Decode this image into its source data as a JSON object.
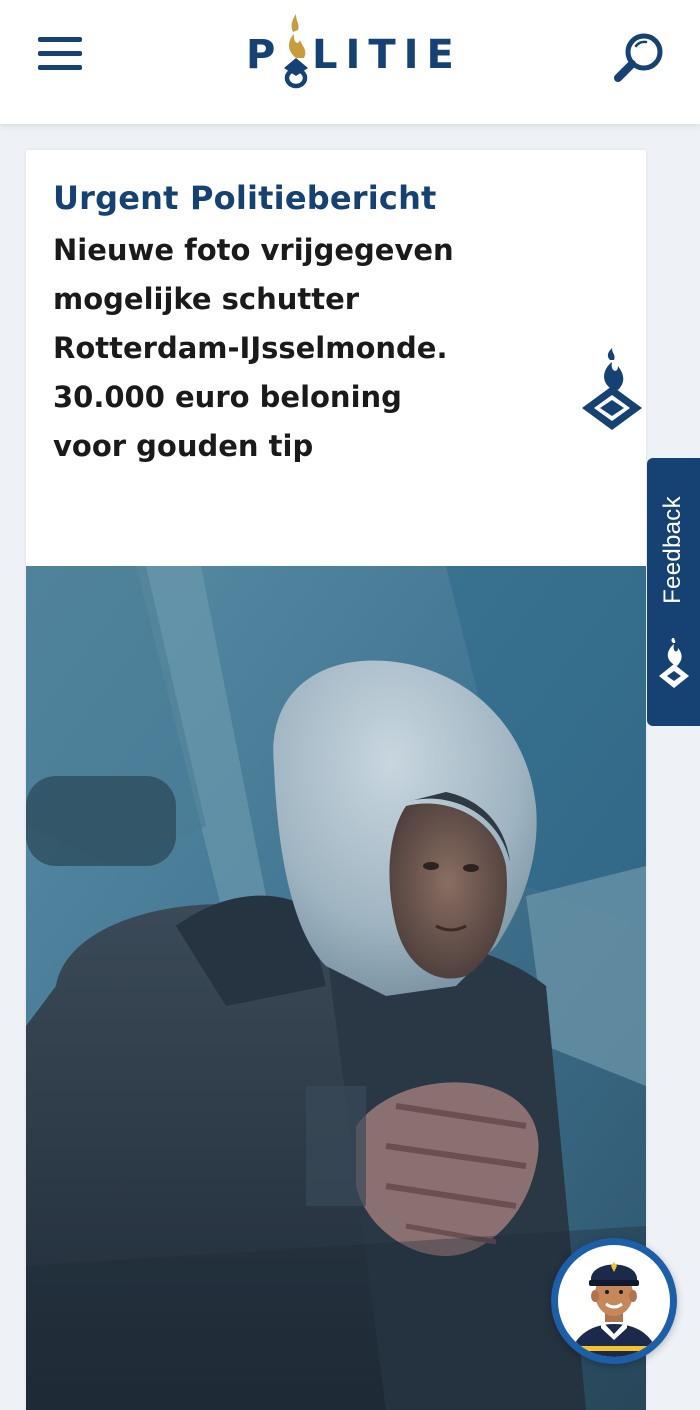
{
  "header": {
    "menu_icon": "hamburger-menu-icon",
    "logo_text_start": "P",
    "logo_text_end": "LITIE",
    "search_icon": "search-icon"
  },
  "article": {
    "label": "Urgent Politiebericht",
    "headline": "Nieuwe foto vrijgegeven\nmogelijke schutter\nRotterdam-IJsselmonde.\n30.000 euro beloning\nvoor gouden tip",
    "emblem_icon": "politie-flame-emblem-icon",
    "photo": "surveillance-photo-hooded-suspect"
  },
  "feedback": {
    "label": "Feedback",
    "icon": "politie-flame-icon"
  },
  "chat": {
    "icon": "police-officer-avatar-icon"
  },
  "colors": {
    "brand_blue": "#154273",
    "gold": "#c89b3c",
    "background": "#eef1f5",
    "text": "#1a1a1a"
  }
}
